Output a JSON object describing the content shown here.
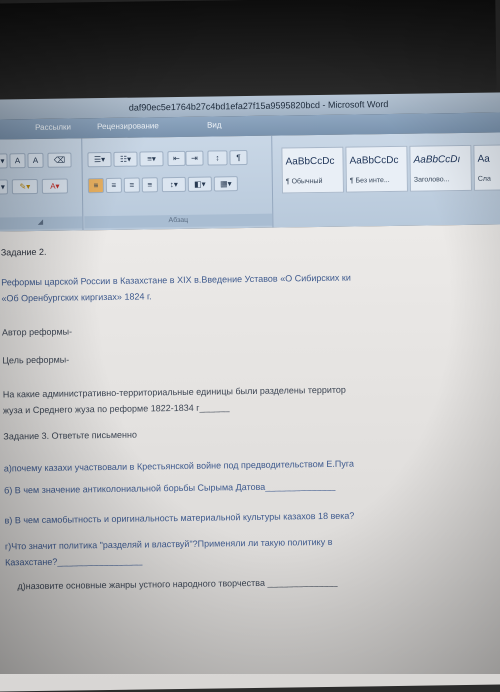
{
  "window": {
    "title": "daf90ec5e1764b27c4bd1efa27f15a9595820bcd - Microsoft Word"
  },
  "ribbon": {
    "tabs": [
      {
        "label": "Рассылки"
      },
      {
        "label": "Рецензирование"
      },
      {
        "label": "Вид"
      }
    ],
    "font_buttons": {
      "grow": "A",
      "shrink": "A"
    },
    "paragraph_group_label": "Абзац",
    "styles": [
      {
        "sample": "AaBbCcDc",
        "name": "¶ Обычный"
      },
      {
        "sample": "AaBbCcDc",
        "name": "¶ Без инте..."
      },
      {
        "sample": "AaBbCcDı",
        "name": "Заголово..."
      },
      {
        "sample": "Aa",
        "name": "Сла"
      }
    ]
  },
  "doc": {
    "task2_title": "Задание 2.",
    "task2_line1": "Реформы царской России в Казахстане в XIX в.Введение Уставов «О Сибирских ки",
    "task2_line2": "«Об Оренбургских киргизах» 1824 г.",
    "author": "Автор реформы-",
    "goal": "Цель реформы-",
    "q_line1": "На какие административно-территориальные единицы были разделены территор",
    "q_line2": "жуза и Среднего жуза  по реформе 1822-1834 г______",
    "task3_title": "Задание 3. Ответьте письменно",
    "a": "а)почему казахи участвовали в Крестьянской войне под предводительством  Е.Пуга",
    "b": "б) В чем значение антиколониальной борьбы Сырыма Датова______________",
    "c": "в) В чем самобытность и оригинальность материальной культуры казахов 18 века?",
    "d_line1": "г)Что значит политика \"разделяй и властвуй\"?Применяли ли такую политику в",
    "d_line2": "Казахстане?_________________",
    "e": "д)назовите основные жанры устного народного творчества ______________"
  }
}
